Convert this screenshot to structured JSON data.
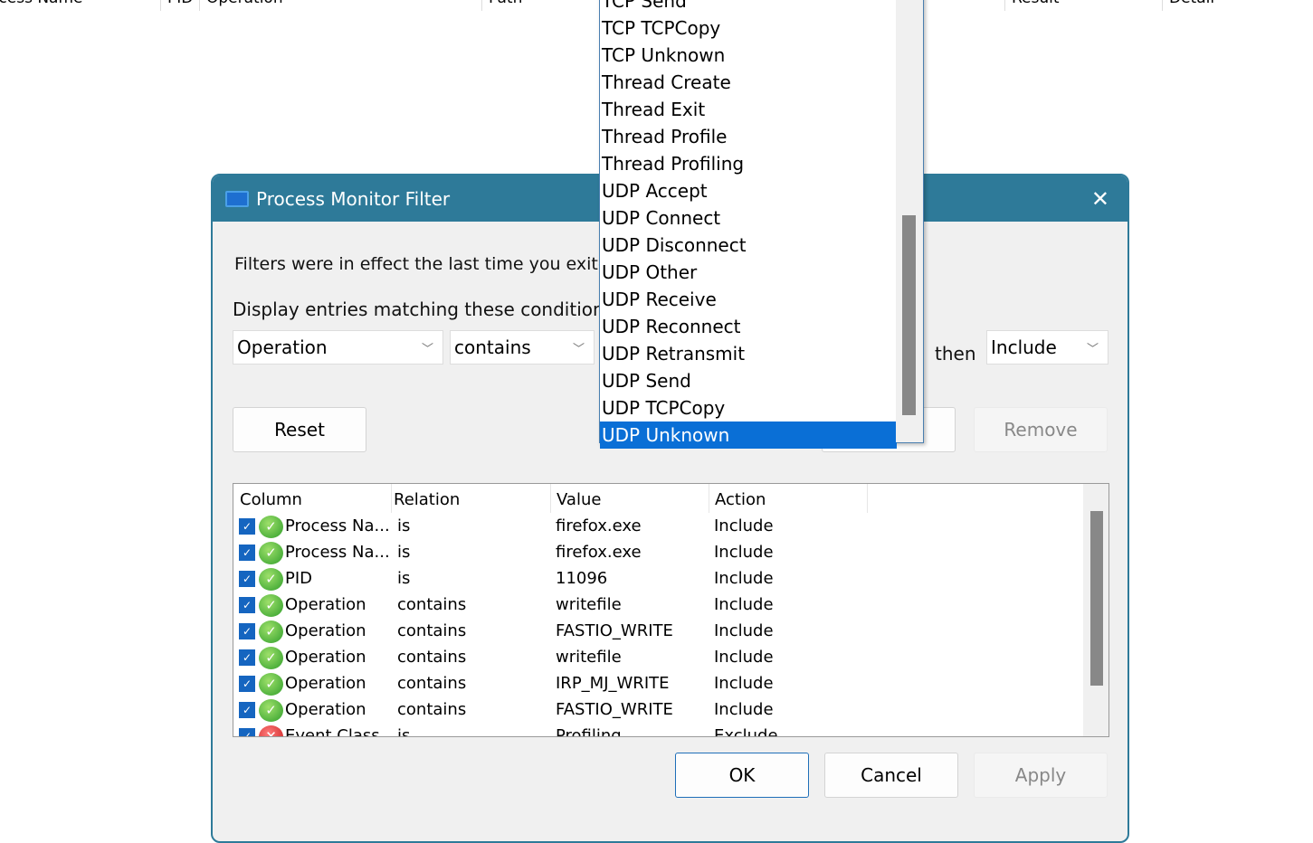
{
  "background_columns": [
    "ocess Name",
    "PID",
    "Operation",
    "Path",
    "Result",
    "Detail"
  ],
  "dialog": {
    "title": "Process Monitor Filter",
    "close_icon": "close-icon",
    "info_text": "Filters were in effect the last time you exited",
    "conditions_label": "Display entries matching these conditions:",
    "column_combo": "Operation",
    "relation_combo": "contains",
    "then_label": "then",
    "action_combo": "Include",
    "buttons": {
      "reset": "Reset",
      "remove": "Remove",
      "ok": "OK",
      "cancel": "Cancel",
      "apply": "Apply"
    },
    "list": {
      "headers": [
        "Column",
        "Relation",
        "Value",
        "Action"
      ],
      "rows": [
        {
          "column": "Process Na...",
          "relation": "is",
          "value": "firefox.exe",
          "action": "Include",
          "checked": true,
          "status": "include"
        },
        {
          "column": "Process Na...",
          "relation": "is",
          "value": "firefox.exe",
          "action": "Include",
          "checked": true,
          "status": "include"
        },
        {
          "column": "PID",
          "relation": "is",
          "value": "11096",
          "action": "Include",
          "checked": true,
          "status": "include"
        },
        {
          "column": "Operation",
          "relation": "contains",
          "value": "writefile",
          "action": "Include",
          "checked": true,
          "status": "include"
        },
        {
          "column": "Operation",
          "relation": "contains",
          "value": "FASTIO_WRITE",
          "action": "Include",
          "checked": true,
          "status": "include"
        },
        {
          "column": "Operation",
          "relation": "contains",
          "value": "writefile",
          "action": "Include",
          "checked": true,
          "status": "include"
        },
        {
          "column": "Operation",
          "relation": "contains",
          "value": "IRP_MJ_WRITE",
          "action": "Include",
          "checked": true,
          "status": "include"
        },
        {
          "column": "Operation",
          "relation": "contains",
          "value": "FASTIO_WRITE",
          "action": "Include",
          "checked": true,
          "status": "include"
        },
        {
          "column": "Event Class",
          "relation": "is",
          "value": "Profiling",
          "action": "Exclude",
          "checked": true,
          "status": "exclude"
        }
      ]
    }
  },
  "dropdown": {
    "items": [
      "TCP Send",
      "TCP TCPCopy",
      "TCP Unknown",
      "Thread Create",
      "Thread Exit",
      "Thread Profile",
      "Thread Profiling",
      "UDP Accept",
      "UDP Connect",
      "UDP Disconnect",
      "UDP Other",
      "UDP Receive",
      "UDP Reconnect",
      "UDP Retransmit",
      "UDP Send",
      "UDP TCPCopy",
      "UDP Unknown"
    ],
    "selected": "UDP Unknown",
    "selected_color": "#0a6fd6"
  }
}
